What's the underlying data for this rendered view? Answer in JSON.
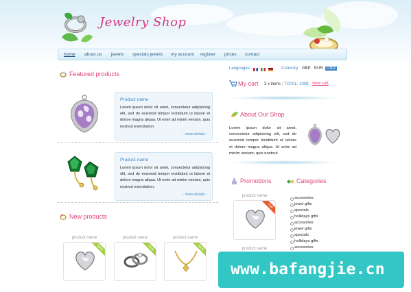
{
  "site": {
    "logo_text": "Jewelry Shop"
  },
  "nav": {
    "items": [
      "home",
      "about us",
      "jewels",
      "specials jewels",
      "my account",
      "register",
      "prices",
      "contact"
    ]
  },
  "featured": {
    "title": "Featured products",
    "products": [
      {
        "name": "Product name",
        "description": "Lorem ipsum dolor sit amet, consectetur adipisicing elit, sed do eiusmod tempor incididunt ut labore et dolore magna aliqua. Ut enim ad minim veniam, quis nostrud exercitation.",
        "more": "- more details -"
      },
      {
        "name": "Product name",
        "description": "Lorem ipsum dolor sit amet, consectetur adipisicing elit, sed do eiusmod tempor incididunt ut labore et dolore magna aliqua. Ut enim ad minim veniam, quis nostrud exercitation.",
        "more": "- more details -"
      }
    ]
  },
  "new_products": {
    "title": "New products",
    "items": [
      {
        "label": "product name",
        "badge": "NEW"
      },
      {
        "label": "product name",
        "badge": "NEW"
      },
      {
        "label": "product name",
        "badge": "NEW"
      }
    ]
  },
  "top_bar": {
    "languages_label": "Languages:",
    "currency_label": "Currency:",
    "currencies": [
      "GBP",
      "EUR",
      "USD"
    ],
    "selected_currency": "USD"
  },
  "cart": {
    "title": "My cart",
    "items_text": "3 x items",
    "total_text": "TOTAL: 100$",
    "view_link": "view cart"
  },
  "about": {
    "title": "About Our Shop",
    "text": "Lorem ipsum dolor sit amet, consectetur adipisicing elit, sed do eiusmod tempor incididunt ut labore et dolore magna aliqua. Ut enim ad minim veniam, quis nostrud."
  },
  "promotions": {
    "title": "Promotions",
    "items": [
      {
        "label": "product name",
        "badge": "TOP"
      },
      {
        "label": "product name"
      }
    ]
  },
  "categories": {
    "title": "Categories",
    "items": [
      "accesories",
      "jewel gifts",
      "specials",
      "hollidays gifts",
      "accesories",
      "jewel gifts",
      "specials",
      "hollidays gifts",
      "accesories"
    ]
  },
  "watermark": {
    "text": "www.bafangjie.cn"
  },
  "colors": {
    "accent_pink": "#e0427f",
    "link_blue": "#3c85c7",
    "header_sky": "#dbeef8",
    "watermark_teal": "#32c7c5"
  }
}
